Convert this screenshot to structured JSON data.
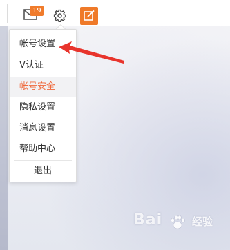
{
  "header": {
    "mail_badge": "19",
    "icons": [
      "mail-icon",
      "gear-icon",
      "edit-icon"
    ],
    "accent_color": "#ef7a29"
  },
  "settings_menu": {
    "items": [
      {
        "label": "帐号设置",
        "active": false
      },
      {
        "label": "V认证",
        "active": false
      },
      {
        "label": "帐号安全",
        "active": true
      },
      {
        "label": "隐私设置",
        "active": false
      },
      {
        "label": "消息设置",
        "active": false
      },
      {
        "label": "帮助中心",
        "active": false
      }
    ],
    "logout_label": "退出",
    "active_color": "#ef6a3c"
  },
  "annotation": {
    "color": "#e8342c"
  },
  "watermark": {
    "text": "Bai",
    "text_suffix": "经验"
  }
}
